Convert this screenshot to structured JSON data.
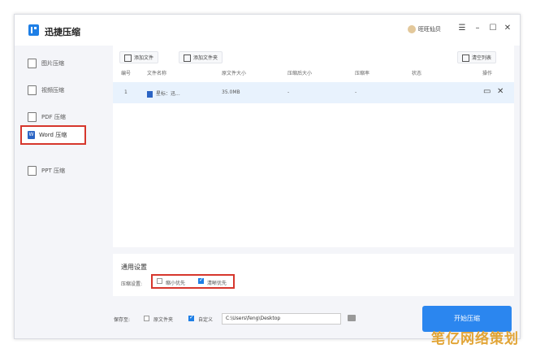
{
  "app": {
    "title": "迅捷压缩",
    "user": "旺旺仙贝"
  },
  "window_controls": {
    "menu": "☰",
    "minimize": "–",
    "maximize": "☐",
    "close": "✕"
  },
  "sidebar": {
    "items": [
      {
        "label": "图片压缩",
        "icon": "image-icon"
      },
      {
        "label": "视频压缩",
        "icon": "video-icon"
      },
      {
        "label": "PDF 压缩",
        "icon": "pdf-icon"
      },
      {
        "label": "Word 压缩",
        "icon": "word-icon",
        "selected": true
      },
      {
        "label": "PPT 压缩",
        "icon": "ppt-icon"
      }
    ]
  },
  "toolbar": {
    "add_file": "添加文件",
    "add_folder": "添加文件夹",
    "clear_list": "清空列表"
  },
  "table": {
    "headers": [
      "编号",
      "文件名称",
      "原文件大小",
      "压缩后大小",
      "压缩率",
      "状态",
      "操作"
    ],
    "rows": [
      {
        "index": "1",
        "name": "星标：迅...",
        "size": "35.0MB",
        "compressed": "-",
        "ratio": "-",
        "status": ""
      }
    ]
  },
  "settings": {
    "title": "通用设置",
    "label": "压缩设置:",
    "options": [
      {
        "label": "缩小优先",
        "checked": false
      },
      {
        "label": "清晰优先",
        "checked": true
      }
    ]
  },
  "save": {
    "label": "保存至:",
    "original_folder": "原文件夹",
    "original_checked": false,
    "custom": "自定义",
    "custom_checked": true,
    "path": "C:\\Users\\feng\\Desktop"
  },
  "start_button": "开始压缩",
  "watermark": "笔亿网络策划",
  "colors": {
    "accent": "#2b86ef",
    "highlight_box": "#d6372d",
    "row_selected": "#e8f2fd"
  }
}
